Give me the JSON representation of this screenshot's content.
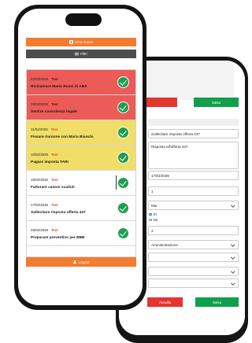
{
  "list_screen": {
    "create_button_label": "Crea nuovo",
    "create_button_icon": "plus-square-icon",
    "filter_button_label": "Filtri",
    "filter_button_icon": "sliders-icon",
    "logout_button_label": "Logout",
    "logout_button_icon": "user-icon",
    "colors": {
      "accent": "#f47c31",
      "filter": "#4d4d4d",
      "overdue": "#ec5b57",
      "due_soon": "#f0de69",
      "done_check": "#1e9e4f"
    },
    "tasks": [
      {
        "date": "02/02/2026",
        "tag": "Test",
        "title": "Richiamare Mario Rossi di ABA",
        "status": "red"
      },
      {
        "date": "02/02/2026",
        "tag": "Test",
        "title": "Sentire consulenza legale",
        "status": "red"
      },
      {
        "date": "11/02/2026",
        "tag": "Test",
        "title": "Fissare riunione con Maria Bianchi",
        "status": "yellow"
      },
      {
        "date": "10/02/2026",
        "tag": "Test",
        "title": "Pagare imposta TARI",
        "status": "yellow"
      },
      {
        "date": "16/02/2026",
        "tag": "Test",
        "title": "Fatturare canoni scaduti",
        "status": "white"
      },
      {
        "date": "17/02/2026",
        "tag": "Test",
        "title": "Sollecitare risposta offerta 437",
        "status": "white"
      },
      {
        "date": "26/02/2026",
        "tag": "Test",
        "title": "Preparare preventivo per BBB",
        "status": "white"
      }
    ]
  },
  "edit_screen": {
    "cancel_label": "Annulla",
    "save_label": "Salva",
    "title_value": "Sollecitare risposta offerta 437",
    "description_value": "Risposta all'offerta 437",
    "date_value": "17/02/2026",
    "quantity_value": "1",
    "frequency_value": "Mai",
    "yes_label": "Sì",
    "no_label": "No",
    "yes_selected": true,
    "number_value": "3",
    "category_value": "Amministrazione",
    "colors": {
      "cancel": "#e5352f",
      "save": "#10a04c"
    }
  }
}
